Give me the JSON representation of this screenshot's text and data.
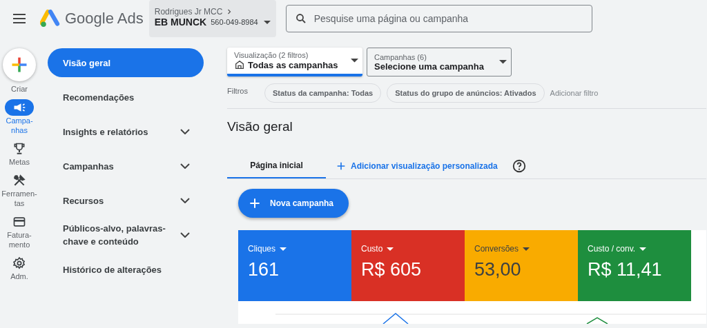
{
  "header": {
    "product": "Google Ads",
    "account": {
      "manager": "Rodrigues Jr MCC",
      "name": "EB MUNCK",
      "id": "560-049-8984"
    },
    "search": {
      "placeholder": "Pesquise uma página ou campanha"
    }
  },
  "rail": {
    "create": "Criar",
    "items": [
      {
        "kind": "campaigns",
        "label": "Campa-\nnhas",
        "selected": true
      },
      {
        "kind": "goals",
        "label": "Metas",
        "selected": false
      },
      {
        "kind": "tools",
        "label": "Ferramen-\ntas",
        "selected": false
      },
      {
        "kind": "billing",
        "label": "Fatura-\nmento",
        "selected": false
      },
      {
        "kind": "admin",
        "label": "Adm.",
        "selected": false
      }
    ]
  },
  "nav": [
    {
      "label": "Visão geral",
      "selected": true,
      "expandable": false
    },
    {
      "label": "Recomendações",
      "selected": false,
      "expandable": false
    },
    {
      "label": "Insights e relatórios",
      "selected": false,
      "expandable": true
    },
    {
      "label": "Campanhas",
      "selected": false,
      "expandable": true
    },
    {
      "label": "Recursos",
      "selected": false,
      "expandable": true
    },
    {
      "label": "Públicos-alvo, palavras-chave e conteúdo",
      "selected": false,
      "expandable": true
    },
    {
      "label": "Histórico de alterações",
      "selected": false,
      "expandable": false
    }
  ],
  "selectors": [
    {
      "label": "Visualização (2 filtros)",
      "value": "Todas as campanhas",
      "selected": true
    },
    {
      "label": "Campanhas (6)",
      "value": "Selecione uma campanha",
      "selected": false
    }
  ],
  "filters": {
    "label": "Filtros",
    "chips": [
      "Status da campanha: Todas",
      "Status do grupo de anúncios: Ativados"
    ],
    "add": "Adicionar filtro"
  },
  "page_title": "Visão geral",
  "tabs": [
    {
      "label": "Página inicial",
      "selected": true
    }
  ],
  "add_view": "Adicionar visualização personalizada",
  "new_campaign": "Nova campanha",
  "metrics": [
    {
      "label": "Cliques",
      "value": "161",
      "color": "#1a73e8"
    },
    {
      "label": "Custo",
      "value": "R$ 605",
      "color": "#d93025"
    },
    {
      "label": "Conversões",
      "value": "53,00",
      "color": "#f9ab00"
    },
    {
      "label": "Custo / conv.",
      "value": "R$ 11,41",
      "color": "#1e8e3e"
    }
  ]
}
